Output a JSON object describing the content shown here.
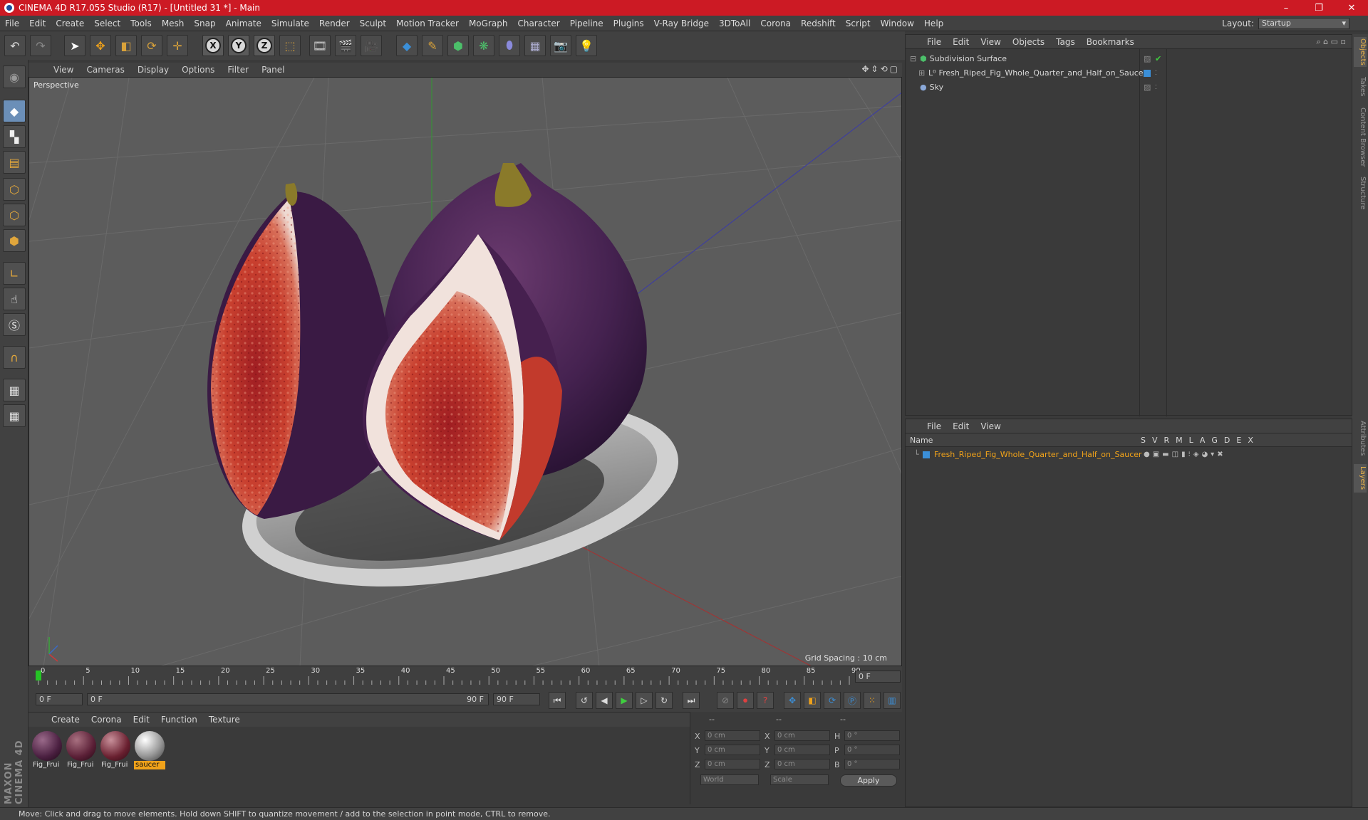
{
  "window": {
    "title": "CINEMA 4D R17.055 Studio (R17) - [Untitled 31 *] - Main",
    "controls": [
      "–",
      "❐",
      "✕"
    ]
  },
  "menubar": {
    "items": [
      "File",
      "Edit",
      "Create",
      "Select",
      "Tools",
      "Mesh",
      "Snap",
      "Animate",
      "Simulate",
      "Render",
      "Sculpt",
      "Motion Tracker",
      "MoGraph",
      "Character",
      "Pipeline",
      "Plugins",
      "V-Ray Bridge",
      "3DToAll",
      "Corona",
      "Redshift",
      "Script",
      "Window",
      "Help"
    ],
    "layout_label": "Layout:",
    "layout_value": "Startup"
  },
  "toolbar": {
    "axis_x": "X",
    "axis_y": "Y",
    "axis_z": "Z"
  },
  "viewport": {
    "menu": [
      "View",
      "Cameras",
      "Display",
      "Options",
      "Filter",
      "Panel"
    ],
    "label": "Perspective",
    "grid_spacing": "Grid Spacing : 10 cm",
    "nav_icons": [
      "✥",
      "⇕",
      "⟲",
      "▢"
    ]
  },
  "timeline": {
    "ticks": [
      "0",
      "5",
      "10",
      "15",
      "20",
      "25",
      "30",
      "35",
      "40",
      "45",
      "50",
      "55",
      "60",
      "65",
      "70",
      "75",
      "80",
      "85",
      "90"
    ],
    "current_frame_field": "0 F",
    "start_field": "0 F",
    "range_start": "0 F",
    "range_end": "90 F",
    "end_field": "90 F"
  },
  "materials": {
    "menu": [
      "Create",
      "Corona",
      "Edit",
      "Function",
      "Texture"
    ],
    "items": [
      {
        "name": "Fig_Frui"
      },
      {
        "name": "Fig_Frui"
      },
      {
        "name": "Fig_Frui"
      },
      {
        "name": "saucer"
      }
    ]
  },
  "coordinates": {
    "headers": [
      "--",
      "--",
      "--"
    ],
    "rows": [
      {
        "a": "X",
        "av": "0 cm",
        "b": "X",
        "bv": "0 cm",
        "c": "H",
        "cv": "0 °"
      },
      {
        "a": "Y",
        "av": "0 cm",
        "b": "Y",
        "bv": "0 cm",
        "c": "P",
        "cv": "0 °"
      },
      {
        "a": "Z",
        "av": "0 cm",
        "b": "Z",
        "bv": "0 cm",
        "c": "B",
        "cv": "0 °"
      }
    ],
    "mode1": "World",
    "mode2": "Scale",
    "apply": "Apply"
  },
  "object_manager": {
    "menu": [
      "File",
      "Edit",
      "View",
      "Objects",
      "Tags",
      "Bookmarks"
    ],
    "objects": [
      {
        "name": "Subdivision Surface"
      },
      {
        "name": "Fresh_Riped_Fig_Whole_Quarter_and_Half_on_Saucer"
      },
      {
        "name": "Sky"
      }
    ]
  },
  "layer_manager": {
    "menu": [
      "File",
      "Edit",
      "View"
    ],
    "col_name": "Name",
    "cols": [
      "S",
      "V",
      "R",
      "M",
      "L",
      "A",
      "G",
      "D",
      "E",
      "X"
    ],
    "layer": "Fresh_Riped_Fig_Whole_Quarter_and_Half_on_Saucer"
  },
  "right_tabs": [
    "Objects",
    "Takes",
    "Content Browser",
    "Structure",
    "Attributes",
    "Layers"
  ],
  "status": "Move: Click and drag to move elements. Hold down SHIFT to quantize movement / add to the selection in point mode, CTRL to remove.",
  "brand": "MAXON CINEMA 4D",
  "colors": {
    "title_bar": "#cc1a24",
    "accent": "#f0a21a",
    "layer_name": "#f0a21a"
  }
}
